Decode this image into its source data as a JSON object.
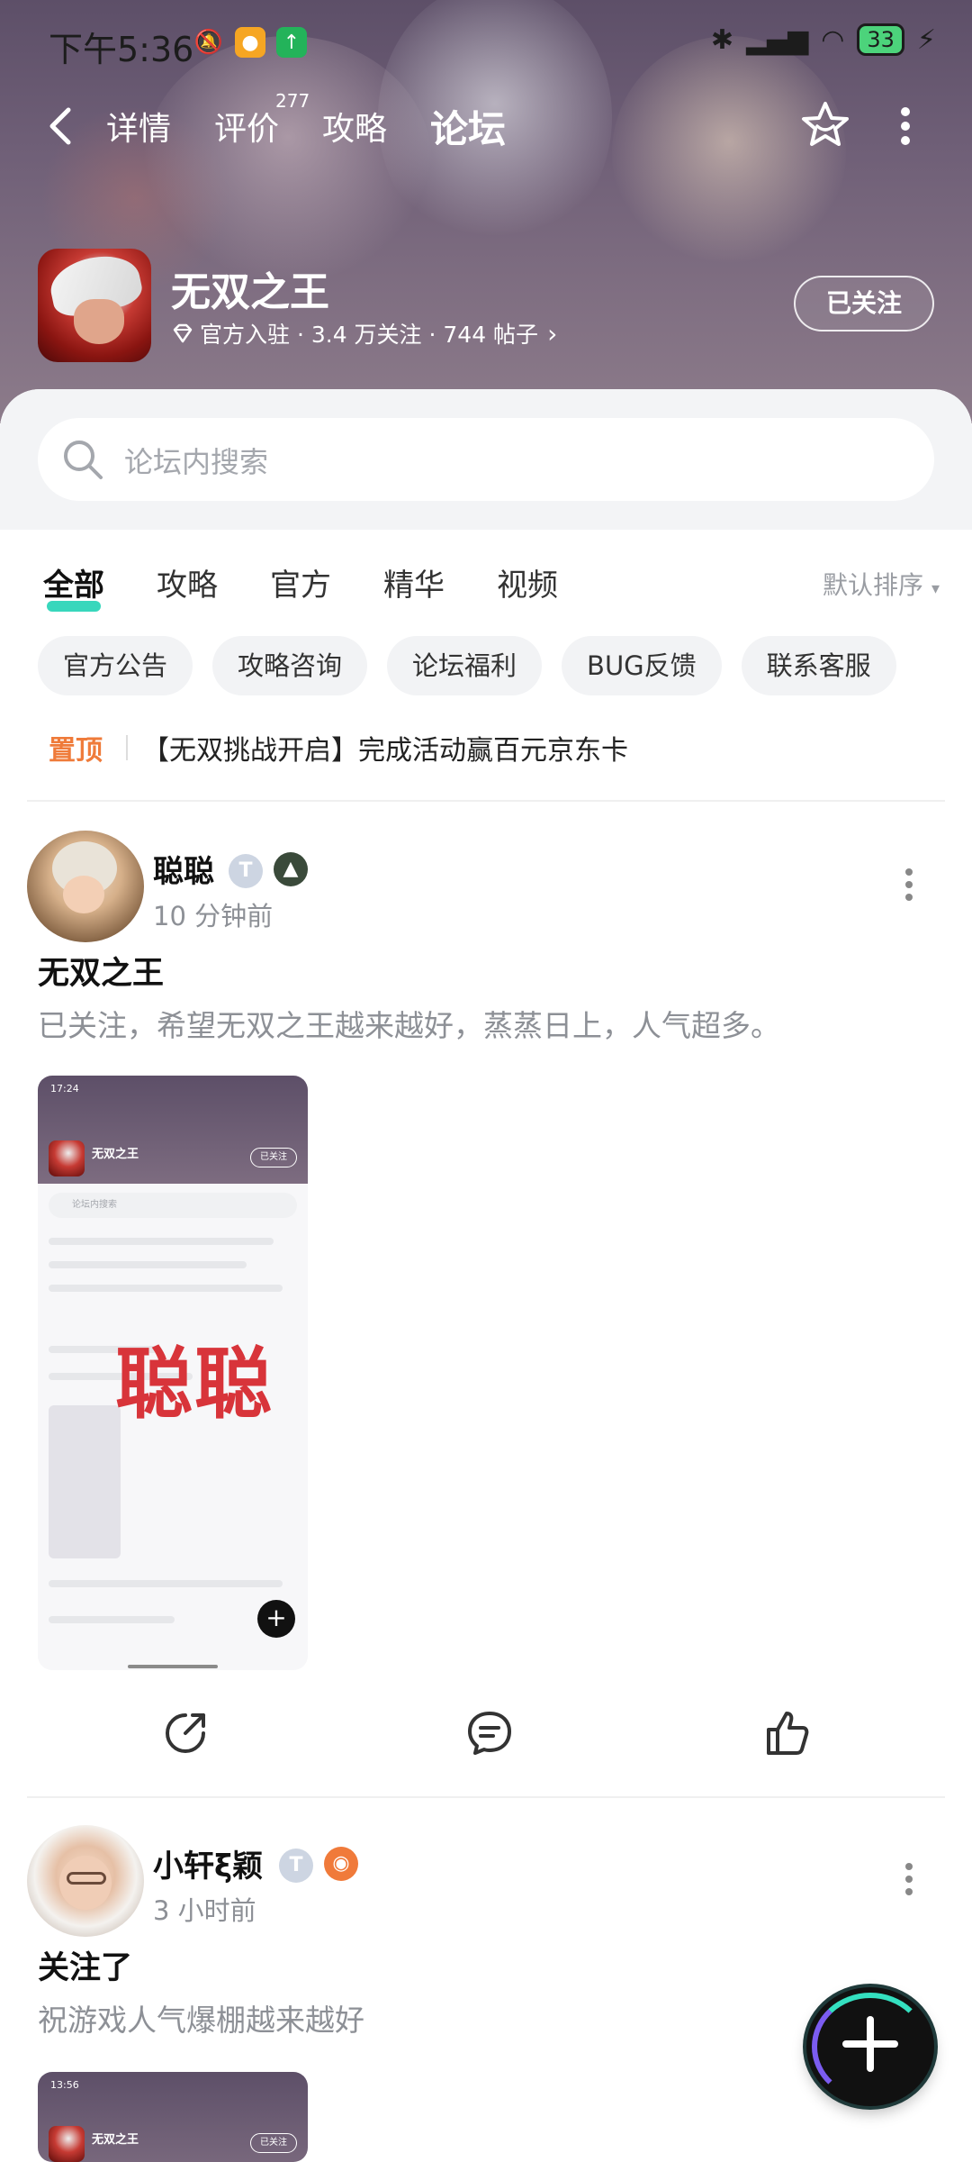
{
  "status_bar": {
    "time": "下午5:36",
    "battery": "33"
  },
  "nav": {
    "tabs": [
      {
        "label": "详情"
      },
      {
        "label": "评价"
      },
      {
        "label": "攻略"
      },
      {
        "label": "论坛"
      }
    ],
    "review_count": "277",
    "active_tab": "论坛"
  },
  "game": {
    "name": "无双之王",
    "meta": "官方入驻 · 3.4 万关注 · 744 帖子",
    "follow_label": "已关注"
  },
  "search": {
    "placeholder": "论坛内搜索"
  },
  "filter_tabs": [
    {
      "label": "全部"
    },
    {
      "label": "攻略"
    },
    {
      "label": "官方"
    },
    {
      "label": "精华"
    },
    {
      "label": "视频"
    }
  ],
  "sort_label": "默认排序",
  "chips": [
    {
      "label": "官方公告"
    },
    {
      "label": "攻略咨询"
    },
    {
      "label": "论坛福利"
    },
    {
      "label": "BUG反馈"
    },
    {
      "label": "联系客服"
    }
  ],
  "pinned": {
    "tag": "置顶",
    "text": "【无双挑战开启】完成活动赢百元京东卡"
  },
  "posts": [
    {
      "author": "聪聪",
      "time": "10 分钟前",
      "title": "无双之王",
      "body": "已关注，希望无双之王越来越好，蒸蒸日上，人气超多。",
      "watermark": "聪聪",
      "thumb_time": "17:24",
      "thumb_game": "无双之王",
      "thumb_follow": "已关注",
      "thumb_search": "论坛内搜索"
    },
    {
      "author": "小轩ξ颖",
      "time": "3 小时前",
      "title": "关注了",
      "body": "祝游戏人气爆棚越来越好",
      "thumb_time": "13:56",
      "thumb_game": "无双之王",
      "thumb_follow": "已关注"
    }
  ],
  "colors": {
    "accent": "#22d3b5",
    "pinned": "#ef7b3a",
    "banner": "#6f5f77"
  }
}
